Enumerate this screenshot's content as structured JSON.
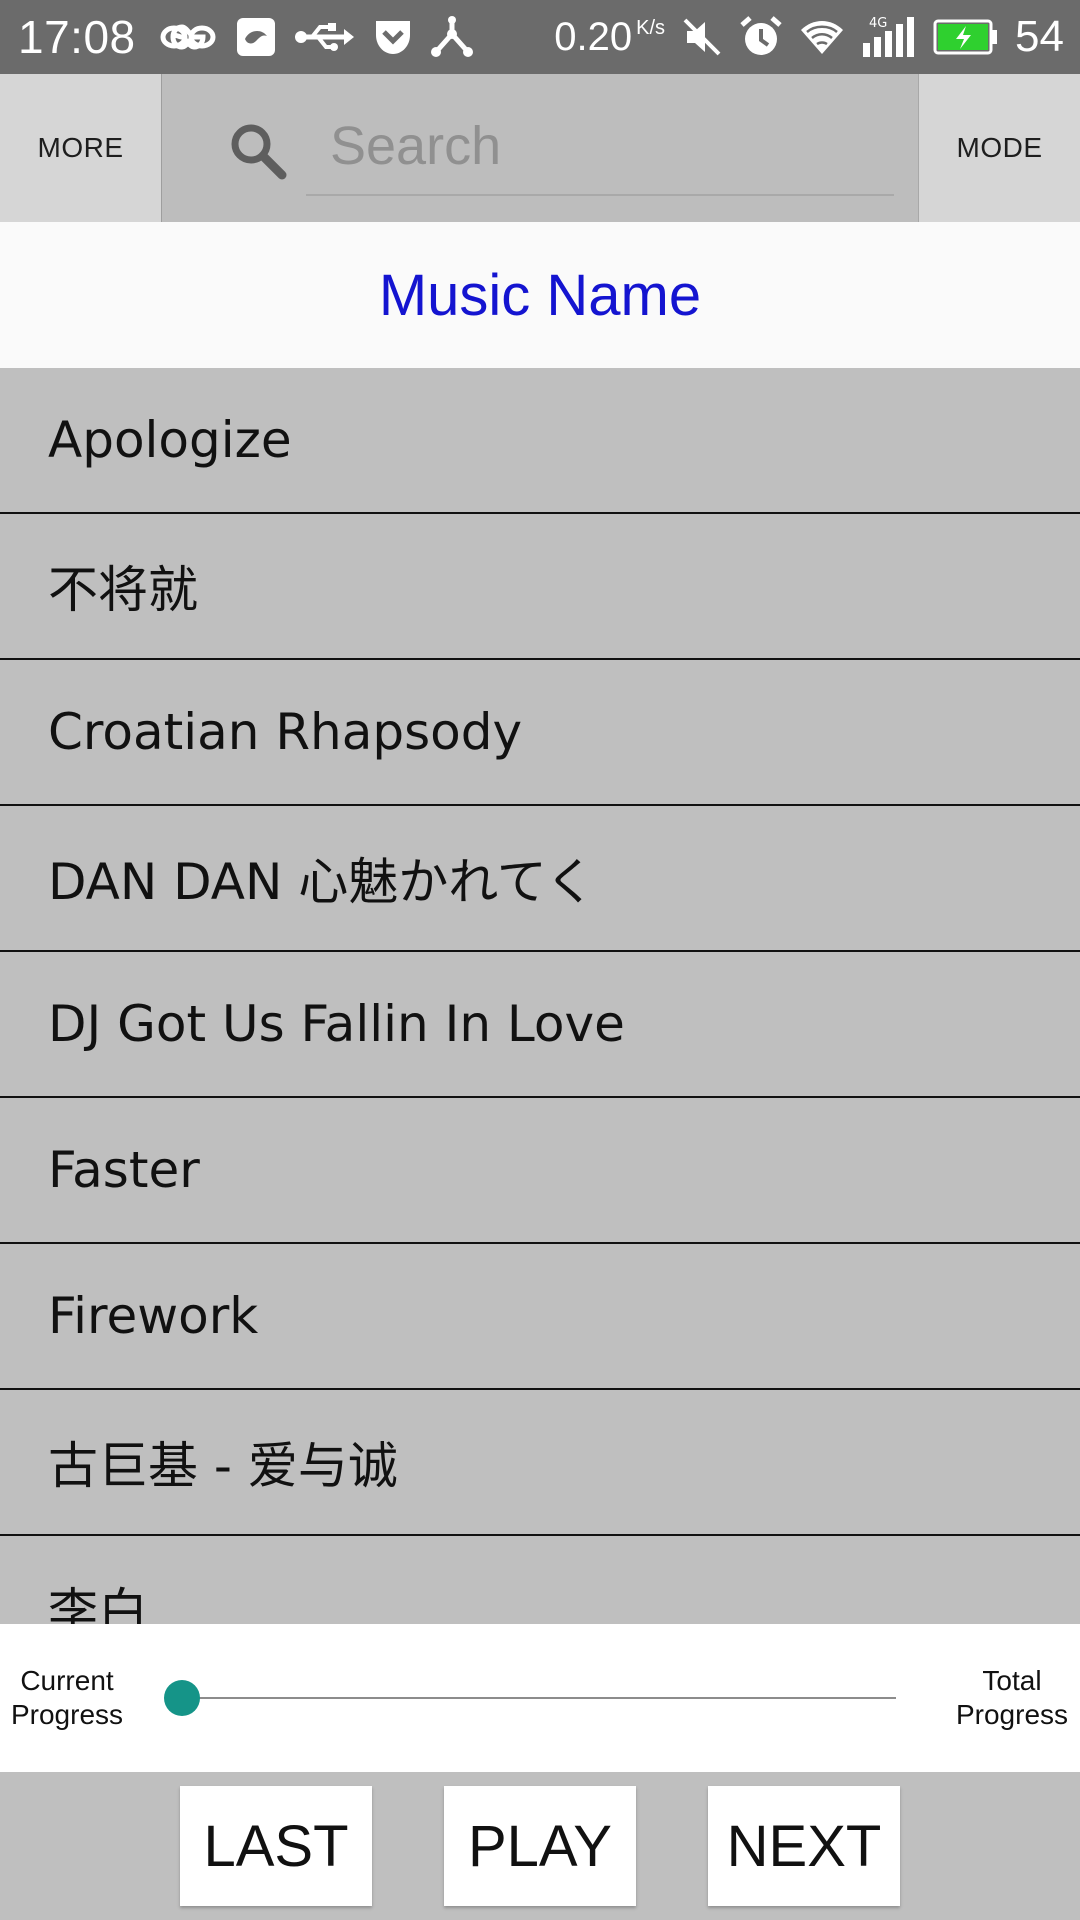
{
  "status_bar": {
    "time": "17:08",
    "network_speed": "0.20",
    "network_speed_unit": "K/s",
    "network_type": "4G",
    "battery_percent": "54",
    "battery_color": "#2fd02f",
    "icons": [
      "infinity-icon",
      "app-icon",
      "usb-icon",
      "pocket-icon",
      "share-icon",
      "mute-icon",
      "alarm-icon",
      "wifi-icon",
      "signal-icon",
      "battery-icon"
    ]
  },
  "toolbar": {
    "more_label": "MORE",
    "mode_label": "MODE",
    "search_placeholder": "Search",
    "search_value": ""
  },
  "header": {
    "title": "Music Name",
    "title_color": "#1414d0"
  },
  "songs": [
    "Apologize",
    "不将就",
    "Croatian Rhapsody",
    "DAN DAN 心魅かれてく",
    "DJ Got Us Fallin In Love",
    "Faster",
    "Firework",
    "古巨基 - 爱与诚",
    "李白"
  ],
  "progress": {
    "current_label": "Current\nProgress",
    "total_label": "Total\nProgress",
    "value": 0,
    "accent_color": "#159488"
  },
  "controls": {
    "last_label": "LAST",
    "play_label": "PLAY",
    "next_label": "NEXT"
  }
}
